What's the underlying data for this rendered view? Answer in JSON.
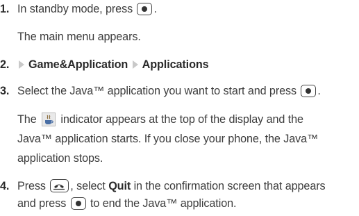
{
  "steps": [
    {
      "num": "1.",
      "a": "In standby mode, press",
      "b": "."
    },
    {
      "note": "The main menu appears."
    },
    {
      "num": "2.",
      "menu1": "Game&Application",
      "menu2": "Applications"
    },
    {
      "num": "3.",
      "a": "Select the Java™ application you want to start and press",
      "b": "."
    },
    {
      "note_lines": [
        {
          "a": "The",
          "b": "indicator appears at the top of the display and the"
        },
        {
          "t": "Java™ application starts. If you close your phone, the Java™"
        },
        {
          "t": "application stops."
        }
      ]
    },
    {
      "num": "4.",
      "a": "Press",
      "b": ", select",
      "quit": "Quit",
      "c": "in the confirmation screen that appears"
    },
    {
      "cont": {
        "a": "and press",
        "b": "to end the Java™ application."
      }
    }
  ],
  "icons": {
    "center_key": "center-key-icon",
    "end_key": "end-key-icon",
    "java_indicator": "java-indicator-icon",
    "menu_arrow": "menu-arrow-icon"
  }
}
